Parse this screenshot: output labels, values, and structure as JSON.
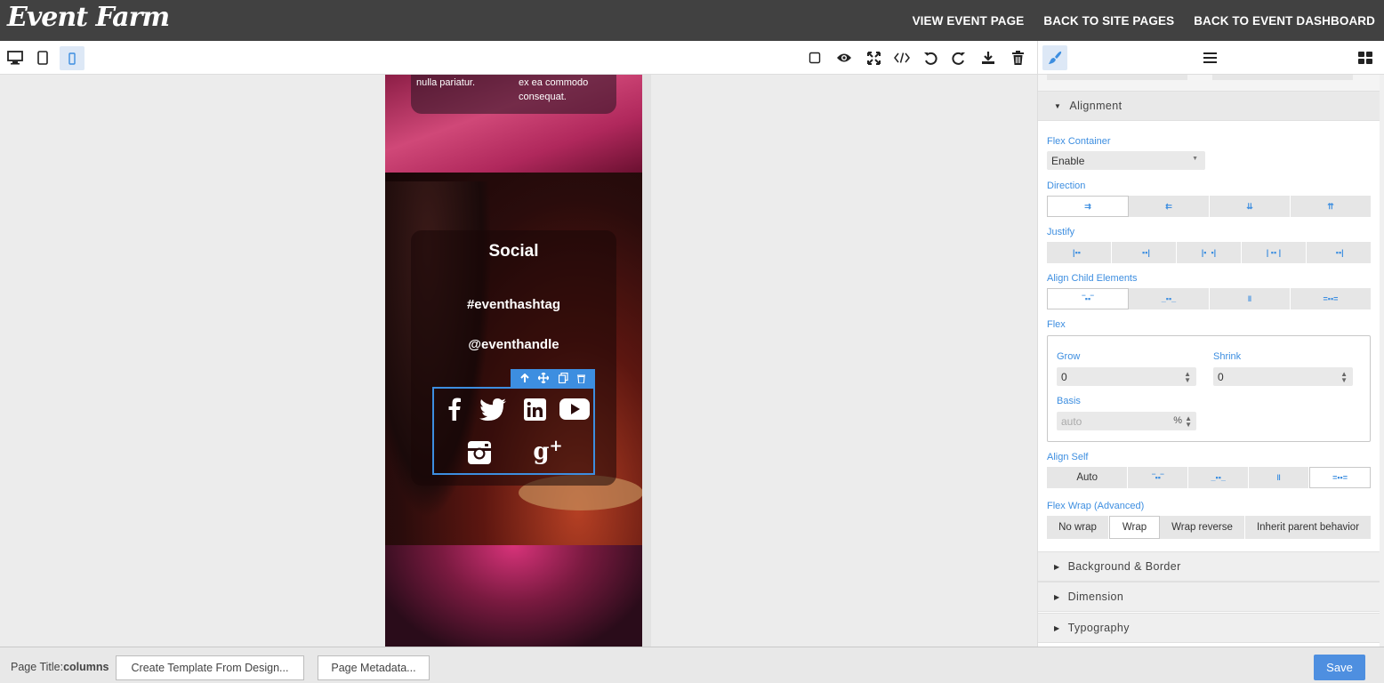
{
  "header": {
    "logo": "Event Farm",
    "links": [
      "VIEW EVENT PAGE",
      "BACK TO SITE PAGES",
      "BACK TO EVENT DASHBOARD"
    ]
  },
  "toolbar": {
    "devices": [
      "desktop-icon",
      "tablet-icon",
      "mobile-icon"
    ],
    "active_device": "mobile",
    "actions": [
      "square-outline-icon",
      "eye-icon",
      "fullscreen-icon",
      "code-icon",
      "undo-icon",
      "redo-icon",
      "import-icon",
      "trash-icon"
    ]
  },
  "preview": {
    "top_text_left": "nulla pariatur.",
    "top_text_right_1": "ex ea commodo",
    "top_text_right_2": "consequat.",
    "social_title": "Social",
    "hashtag": "#eventhashtag",
    "handle": "@eventhandle",
    "social_icons": [
      "facebook-icon",
      "twitter-icon",
      "linkedin-icon",
      "youtube-icon",
      "instagram-icon",
      "google-plus-icon"
    ],
    "selection_toolbar": [
      "arrow-up-icon",
      "move-icon",
      "copy-icon",
      "trash-icon"
    ]
  },
  "panel": {
    "tabs": [
      "paint-brush-icon",
      "hamburger-menu-icon",
      "blocks-grid-icon"
    ],
    "alignment_header": "Alignment",
    "flex_container_label": "Flex Container",
    "flex_container_value": "Enable",
    "direction_label": "Direction",
    "justify_label": "Justify",
    "align_child_label": "Align Child Elements",
    "flex_label": "Flex",
    "grow_label": "Grow",
    "grow_value": "0",
    "shrink_label": "Shrink",
    "shrink_value": "0",
    "basis_label": "Basis",
    "basis_placeholder": "auto",
    "basis_unit": "%",
    "align_self_label": "Align Self",
    "align_self_auto": "Auto",
    "flex_wrap_label": "Flex Wrap (Advanced)",
    "flex_wrap_options": [
      "No wrap",
      "Wrap",
      "Wrap reverse",
      "Inherit parent behavior"
    ],
    "flex_wrap_selected": "Wrap",
    "sections": [
      "Background & Border",
      "Dimension",
      "Typography"
    ]
  },
  "footer": {
    "page_title_label": "Page Title:",
    "page_title_value": "columns",
    "create_template_button": "Create Template From Design...",
    "page_metadata_button": "Page Metadata...",
    "save_button": "Save"
  },
  "colors": {
    "accent": "#3d8ee0",
    "header_bg": "#414141",
    "save_bg": "#4e8fe0"
  }
}
